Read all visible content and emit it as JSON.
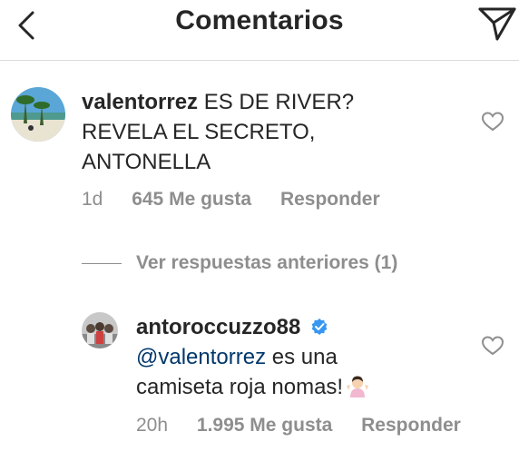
{
  "header": {
    "title": "Comentarios",
    "back_icon": "chevron-left-icon",
    "send_icon": "paper-plane-icon"
  },
  "comment": {
    "username": "valentorrez",
    "text_line1": "ES DE RIVER?",
    "text_line2": "REVELA EL SECRETO,",
    "text_line3": "ANTONELLA",
    "time": "1d",
    "likes": "645 Me gusta",
    "reply_label": "Responder"
  },
  "view_replies": "Ver respuestas anteriores (1)",
  "reply": {
    "username": "antoroccuzzo88",
    "mention": "@valentorrez",
    "text_line1": "es una",
    "text_line2": "camiseta roja nomas!",
    "emoji": "person-shrugging-emoji",
    "time": "20h",
    "likes": "1.995 Me gusta",
    "reply_label": "Responder"
  },
  "colors": {
    "text": "#262626",
    "secondary": "#8e8e8e",
    "mention": "#00376b",
    "verified": "#3897f0",
    "divider": "#dbdbdb"
  }
}
